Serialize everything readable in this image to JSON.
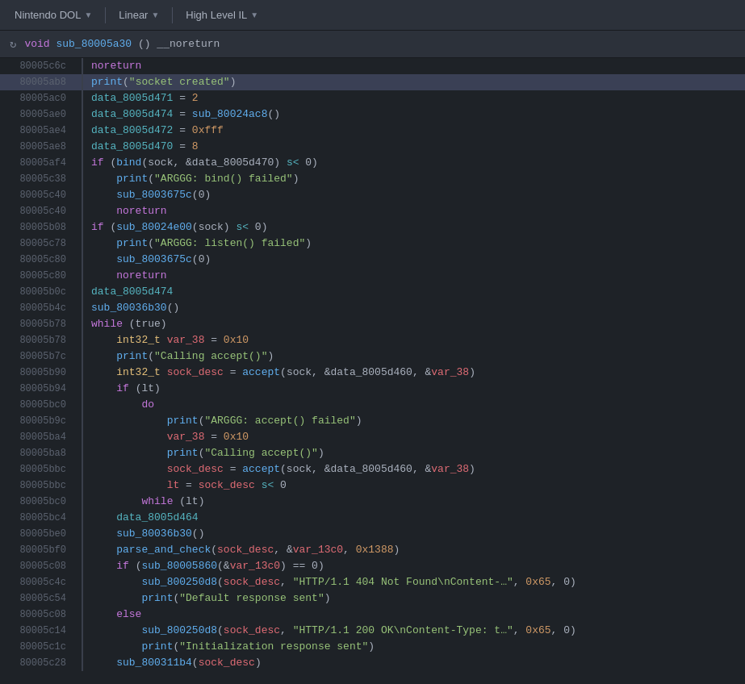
{
  "toolbar": {
    "items": [
      {
        "id": "nintendo-dol",
        "label": "Nintendo DOL",
        "has_arrow": true
      },
      {
        "id": "linear",
        "label": "Linear",
        "has_arrow": true
      },
      {
        "id": "high-level-il",
        "label": "High Level IL",
        "has_arrow": true
      }
    ]
  },
  "func_header": {
    "func_keyword": "void",
    "func_name": "sub_80005a30",
    "func_params": "()",
    "func_attr": "__noreturn"
  },
  "code_lines": [
    {
      "addr": "80005c6c",
      "highlighted": false,
      "tokens": [
        {
          "t": "kw",
          "v": "noreturn"
        }
      ]
    },
    {
      "addr": "80005ab8",
      "highlighted": true,
      "tokens": [
        {
          "t": "fn",
          "v": "print"
        },
        {
          "t": "plain",
          "v": "("
        },
        {
          "t": "str",
          "v": "\"socket created\""
        },
        {
          "t": "plain",
          "v": ")"
        }
      ]
    },
    {
      "addr": "80005ac0",
      "highlighted": false,
      "tokens": [
        {
          "t": "addr-ref",
          "v": "data_8005d471"
        },
        {
          "t": "plain",
          "v": " = "
        },
        {
          "t": "num",
          "v": "2"
        }
      ]
    },
    {
      "addr": "80005ae0",
      "highlighted": false,
      "tokens": [
        {
          "t": "addr-ref",
          "v": "data_8005d474"
        },
        {
          "t": "plain",
          "v": " = "
        },
        {
          "t": "fn",
          "v": "sub_80024ac8"
        },
        {
          "t": "plain",
          "v": "()"
        }
      ]
    },
    {
      "addr": "80005ae4",
      "highlighted": false,
      "tokens": [
        {
          "t": "addr-ref",
          "v": "data_8005d472"
        },
        {
          "t": "plain",
          "v": " = "
        },
        {
          "t": "num",
          "v": "0xfff"
        }
      ]
    },
    {
      "addr": "80005ae8",
      "highlighted": false,
      "tokens": [
        {
          "t": "addr-ref",
          "v": "data_8005d470"
        },
        {
          "t": "plain",
          "v": " = "
        },
        {
          "t": "num",
          "v": "8"
        }
      ]
    },
    {
      "addr": "80005af4",
      "highlighted": false,
      "tokens": [
        {
          "t": "kw",
          "v": "if"
        },
        {
          "t": "plain",
          "v": " ("
        },
        {
          "t": "fn",
          "v": "bind"
        },
        {
          "t": "plain",
          "v": "(sock, &data_8005d470) "
        },
        {
          "t": "op",
          "v": "s<"
        },
        {
          "t": "plain",
          "v": " 0)"
        }
      ]
    },
    {
      "addr": "80005c38",
      "highlighted": false,
      "indent": 1,
      "tokens": [
        {
          "t": "fn",
          "v": "print"
        },
        {
          "t": "plain",
          "v": "("
        },
        {
          "t": "str",
          "v": "\"ARGGG: bind() failed\""
        },
        {
          "t": "plain",
          "v": ")"
        }
      ]
    },
    {
      "addr": "80005c40",
      "highlighted": false,
      "indent": 1,
      "tokens": [
        {
          "t": "fn",
          "v": "sub_8003675c"
        },
        {
          "t": "plain",
          "v": "(0)"
        }
      ]
    },
    {
      "addr": "80005c40",
      "highlighted": false,
      "indent": 1,
      "tokens": [
        {
          "t": "kw",
          "v": "noreturn"
        }
      ]
    },
    {
      "addr": "80005b08",
      "highlighted": false,
      "tokens": [
        {
          "t": "kw",
          "v": "if"
        },
        {
          "t": "plain",
          "v": " ("
        },
        {
          "t": "fn",
          "v": "sub_80024e00"
        },
        {
          "t": "plain",
          "v": "(sock) "
        },
        {
          "t": "op",
          "v": "s<"
        },
        {
          "t": "plain",
          "v": " 0)"
        }
      ]
    },
    {
      "addr": "80005c78",
      "highlighted": false,
      "indent": 1,
      "tokens": [
        {
          "t": "fn",
          "v": "print"
        },
        {
          "t": "plain",
          "v": "("
        },
        {
          "t": "str",
          "v": "\"ARGGG: listen() failed\""
        },
        {
          "t": "plain",
          "v": ")"
        }
      ]
    },
    {
      "addr": "80005c80",
      "highlighted": false,
      "indent": 1,
      "tokens": [
        {
          "t": "fn",
          "v": "sub_8003675c"
        },
        {
          "t": "plain",
          "v": "(0)"
        }
      ]
    },
    {
      "addr": "80005c80",
      "highlighted": false,
      "indent": 1,
      "tokens": [
        {
          "t": "kw",
          "v": "noreturn"
        }
      ]
    },
    {
      "addr": "80005b0c",
      "highlighted": false,
      "tokens": [
        {
          "t": "addr-ref",
          "v": "data_8005d474"
        }
      ]
    },
    {
      "addr": "80005b4c",
      "highlighted": false,
      "tokens": [
        {
          "t": "fn",
          "v": "sub_80036b30"
        },
        {
          "t": "plain",
          "v": "()"
        }
      ]
    },
    {
      "addr": "80005b78",
      "highlighted": false,
      "tokens": [
        {
          "t": "kw",
          "v": "while"
        },
        {
          "t": "plain",
          "v": " (true)"
        }
      ]
    },
    {
      "addr": "80005b78",
      "highlighted": false,
      "indent": 1,
      "tokens": [
        {
          "t": "type",
          "v": "int32_t"
        },
        {
          "t": "plain",
          "v": " "
        },
        {
          "t": "var",
          "v": "var_38"
        },
        {
          "t": "plain",
          "v": " = "
        },
        {
          "t": "num",
          "v": "0x10"
        }
      ]
    },
    {
      "addr": "80005b7c",
      "highlighted": false,
      "indent": 1,
      "tokens": [
        {
          "t": "fn",
          "v": "print"
        },
        {
          "t": "plain",
          "v": "("
        },
        {
          "t": "str",
          "v": "\"Calling accept()\""
        },
        {
          "t": "plain",
          "v": ")"
        }
      ]
    },
    {
      "addr": "80005b90",
      "highlighted": false,
      "indent": 1,
      "tokens": [
        {
          "t": "type",
          "v": "int32_t"
        },
        {
          "t": "plain",
          "v": " "
        },
        {
          "t": "var",
          "v": "sock_desc"
        },
        {
          "t": "plain",
          "v": " = "
        },
        {
          "t": "fn",
          "v": "accept"
        },
        {
          "t": "plain",
          "v": "(sock, &data_8005d460, &"
        },
        {
          "t": "var",
          "v": "var_38"
        },
        {
          "t": "plain",
          "v": ")"
        }
      ]
    },
    {
      "addr": "80005b94",
      "highlighted": false,
      "indent": 1,
      "tokens": [
        {
          "t": "kw",
          "v": "if"
        },
        {
          "t": "plain",
          "v": " (lt)"
        }
      ]
    },
    {
      "addr": "80005bc0",
      "highlighted": false,
      "indent": 2,
      "tokens": [
        {
          "t": "kw",
          "v": "do"
        }
      ]
    },
    {
      "addr": "80005b9c",
      "highlighted": false,
      "indent": 3,
      "tokens": [
        {
          "t": "fn",
          "v": "print"
        },
        {
          "t": "plain",
          "v": "("
        },
        {
          "t": "str",
          "v": "\"ARGGG: accept() failed\""
        },
        {
          "t": "plain",
          "v": ")"
        }
      ]
    },
    {
      "addr": "80005ba4",
      "highlighted": false,
      "indent": 3,
      "tokens": [
        {
          "t": "var",
          "v": "var_38"
        },
        {
          "t": "plain",
          "v": " = "
        },
        {
          "t": "num",
          "v": "0x10"
        }
      ]
    },
    {
      "addr": "80005ba8",
      "highlighted": false,
      "indent": 3,
      "tokens": [
        {
          "t": "fn",
          "v": "print"
        },
        {
          "t": "plain",
          "v": "("
        },
        {
          "t": "str",
          "v": "\"Calling accept()\""
        },
        {
          "t": "plain",
          "v": ")"
        }
      ]
    },
    {
      "addr": "80005bbc",
      "highlighted": false,
      "indent": 3,
      "tokens": [
        {
          "t": "var",
          "v": "sock_desc"
        },
        {
          "t": "plain",
          "v": " = "
        },
        {
          "t": "fn",
          "v": "accept"
        },
        {
          "t": "plain",
          "v": "(sock, &data_8005d460, &"
        },
        {
          "t": "var",
          "v": "var_38"
        },
        {
          "t": "plain",
          "v": ")"
        }
      ]
    },
    {
      "addr": "80005bbc",
      "highlighted": false,
      "indent": 3,
      "tokens": [
        {
          "t": "var",
          "v": "lt"
        },
        {
          "t": "plain",
          "v": " = "
        },
        {
          "t": "var",
          "v": "sock_desc"
        },
        {
          "t": "plain",
          "v": " "
        },
        {
          "t": "op",
          "v": "s<"
        },
        {
          "t": "plain",
          "v": " 0"
        }
      ]
    },
    {
      "addr": "80005bc0",
      "highlighted": false,
      "indent": 2,
      "tokens": [
        {
          "t": "kw",
          "v": "while"
        },
        {
          "t": "plain",
          "v": " (lt)"
        }
      ]
    },
    {
      "addr": "80005bc4",
      "highlighted": false,
      "indent": 1,
      "tokens": [
        {
          "t": "addr-ref",
          "v": "data_8005d464"
        }
      ]
    },
    {
      "addr": "80005be0",
      "highlighted": false,
      "indent": 1,
      "tokens": [
        {
          "t": "fn",
          "v": "sub_80036b30"
        },
        {
          "t": "plain",
          "v": "()"
        }
      ]
    },
    {
      "addr": "80005bf0",
      "highlighted": false,
      "indent": 1,
      "tokens": [
        {
          "t": "fn",
          "v": "parse_and_check"
        },
        {
          "t": "plain",
          "v": "("
        },
        {
          "t": "var",
          "v": "sock_desc"
        },
        {
          "t": "plain",
          "v": ", &"
        },
        {
          "t": "var",
          "v": "var_13c0"
        },
        {
          "t": "plain",
          "v": ", "
        },
        {
          "t": "num",
          "v": "0x1388"
        },
        {
          "t": "plain",
          "v": ")"
        }
      ]
    },
    {
      "addr": "80005c08",
      "highlighted": false,
      "indent": 1,
      "tokens": [
        {
          "t": "kw",
          "v": "if"
        },
        {
          "t": "plain",
          "v": " ("
        },
        {
          "t": "fn",
          "v": "sub_80005860"
        },
        {
          "t": "plain",
          "v": "(&"
        },
        {
          "t": "var",
          "v": "var_13c0"
        },
        {
          "t": "plain",
          "v": ") == 0)"
        }
      ]
    },
    {
      "addr": "80005c4c",
      "highlighted": false,
      "indent": 2,
      "tokens": [
        {
          "t": "fn",
          "v": "sub_800250d8"
        },
        {
          "t": "plain",
          "v": "("
        },
        {
          "t": "var",
          "v": "sock_desc"
        },
        {
          "t": "plain",
          "v": ", "
        },
        {
          "t": "str",
          "v": "\"HTTP/1.1 404 Not Found\\nContent-…\""
        },
        {
          "t": "plain",
          "v": ", "
        },
        {
          "t": "num",
          "v": "0x65"
        },
        {
          "t": "plain",
          "v": ", 0)"
        }
      ]
    },
    {
      "addr": "80005c54",
      "highlighted": false,
      "indent": 2,
      "tokens": [
        {
          "t": "fn",
          "v": "print"
        },
        {
          "t": "plain",
          "v": "("
        },
        {
          "t": "str",
          "v": "\"Default response sent\""
        },
        {
          "t": "plain",
          "v": ")"
        }
      ]
    },
    {
      "addr": "80005c08",
      "highlighted": false,
      "indent": 1,
      "tokens": [
        {
          "t": "kw",
          "v": "else"
        }
      ]
    },
    {
      "addr": "80005c14",
      "highlighted": false,
      "indent": 2,
      "tokens": [
        {
          "t": "fn",
          "v": "sub_800250d8"
        },
        {
          "t": "plain",
          "v": "("
        },
        {
          "t": "var",
          "v": "sock_desc"
        },
        {
          "t": "plain",
          "v": ", "
        },
        {
          "t": "str",
          "v": "\"HTTP/1.1 200 OK\\nContent-Type: t…\""
        },
        {
          "t": "plain",
          "v": ", "
        },
        {
          "t": "num",
          "v": "0x65"
        },
        {
          "t": "plain",
          "v": ", 0)"
        }
      ]
    },
    {
      "addr": "80005c1c",
      "highlighted": false,
      "indent": 2,
      "tokens": [
        {
          "t": "fn",
          "v": "print"
        },
        {
          "t": "plain",
          "v": "("
        },
        {
          "t": "str",
          "v": "\"Initialization response sent\""
        },
        {
          "t": "plain",
          "v": ")"
        }
      ]
    },
    {
      "addr": "80005c28",
      "highlighted": false,
      "indent": 1,
      "tokens": [
        {
          "t": "fn",
          "v": "sub_800311b4"
        },
        {
          "t": "plain",
          "v": "("
        },
        {
          "t": "var",
          "v": "sock_desc"
        },
        {
          "t": "plain",
          "v": ")"
        }
      ]
    }
  ]
}
